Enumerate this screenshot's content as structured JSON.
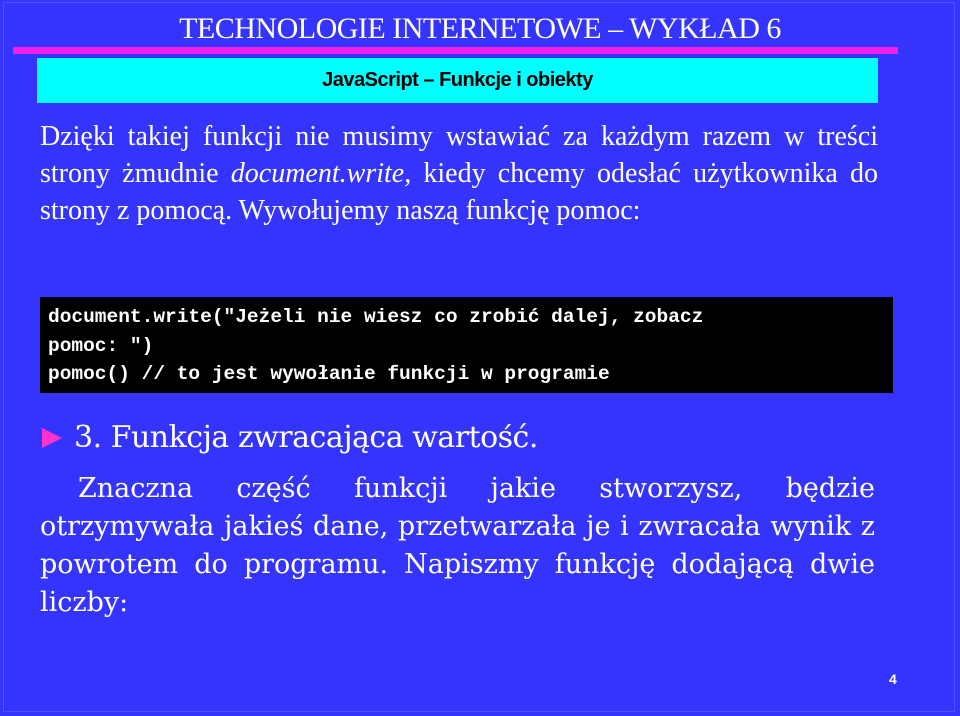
{
  "header": {
    "title": "TECHNOLOGIE  INTERNETOWE – WYKŁAD 6",
    "subtitle": "JavaScript – Funkcje i obiekty"
  },
  "intro": {
    "part1": "Dzięki takiej funkcji nie musimy wstawiać za każdym razem w treści strony żmudnie ",
    "italic": "document.write,",
    "part2": " kiedy chcemy odesłać użytkownika do strony z pomocą. Wywołujemy naszą funkcję pomoc:"
  },
  "code": {
    "lines": [
      "document.write(\"Jeżeli nie wiesz co zrobić dalej, zobacz",
      "pomoc: \")",
      "pomoc() // to jest wywołanie funkcji w programie"
    ]
  },
  "section": {
    "bullet_icon": "triangle-right",
    "bullet_color": "#ff33cc",
    "heading": "3. Funkcja zwracająca wartość.",
    "paragraph": "Znaczna część funkcji jakie stworzysz, będzie otrzymywała jakieś dane, przetwarzała je i zwracała wynik z powrotem do programu. Napiszmy funkcję dodającą dwie liczby:"
  },
  "footer": {
    "page_number": "4"
  },
  "colors": {
    "background": "#3434fc",
    "accent_bar": "#f020e8",
    "subtitle_box": "#00ffff",
    "code_bg": "#000000"
  }
}
